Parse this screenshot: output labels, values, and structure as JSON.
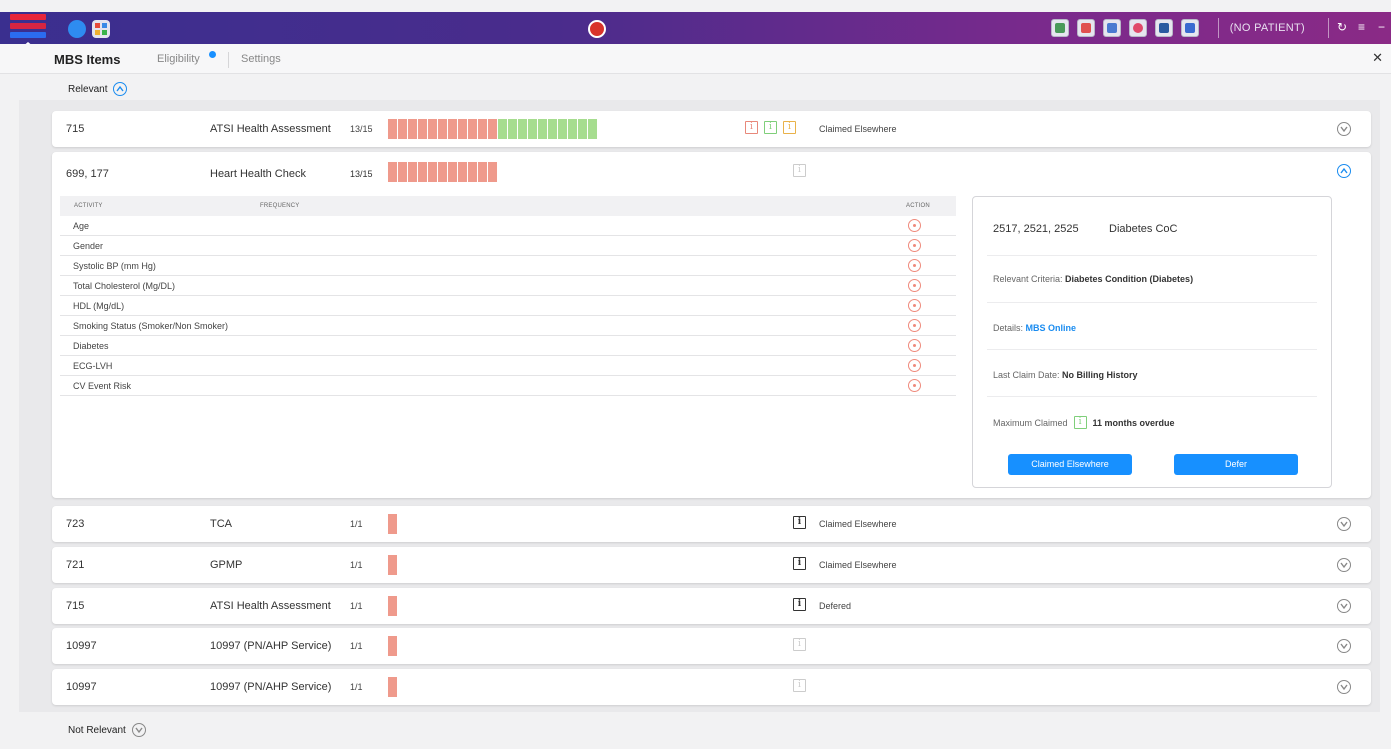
{
  "topbar": {
    "patient_label": "(NO PATIENT)",
    "app_icons": [
      "pathology-icon",
      "mbs-icon",
      "medication-icon",
      "heart-health-icon",
      "qi-icon",
      "mbs-assist-icon"
    ],
    "colors": {
      "bar_start": "#3a2f8f",
      "bar_end": "#8a2a86",
      "stripe_red": "#e8253a",
      "stripe_blue": "#2b6cf0"
    }
  },
  "tabs": [
    {
      "label": "MBS Items",
      "active": true
    },
    {
      "label": "Eligibility",
      "active": false
    },
    {
      "label": "Settings",
      "active": false
    }
  ],
  "sections": {
    "relevant": "Relevant",
    "not_relevant": "Not Relevant"
  },
  "rows": [
    {
      "code": "715",
      "name": "ATSI Health Assessment",
      "ratio": "13/15",
      "status": "Claimed Elsewhere"
    },
    {
      "code": "699, 177",
      "name": "Heart Health Check",
      "ratio": "13/15",
      "status": ""
    },
    {
      "code": "723",
      "name": "TCA",
      "ratio": "1/1",
      "status": "Claimed Elsewhere"
    },
    {
      "code": "721",
      "name": "GPMP",
      "ratio": "1/1",
      "status": "Claimed Elsewhere"
    },
    {
      "code": "715",
      "name": "ATSI Health Assessment",
      "ratio": "1/1",
      "status": "Defered"
    },
    {
      "code": "10997",
      "name": "10997 (PN/AHP Service)",
      "ratio": "1/1",
      "status": ""
    },
    {
      "code": "10997",
      "name": "10997 (PN/AHP Service)",
      "ratio": "1/1",
      "status": ""
    }
  ],
  "activity_table": {
    "headers": {
      "activity": "ACTIVITY",
      "frequency": "FREQUENCY",
      "action": "ACTION"
    },
    "activities": [
      "Age",
      "Gender",
      "Systolic BP (mm Hg)",
      "Total Cholesterol (Mg/DL)",
      "HDL (Mg/dL)",
      "Smoking Status (Smoker/Non Smoker)",
      "Diabetes",
      "ECG-LVH",
      "CV Event Risk"
    ]
  },
  "side_card": {
    "codes": "2517, 2521, 2525",
    "title": "Diabetes CoC",
    "criteria_label": "Relevant Criteria:",
    "criteria_value": "Diabetes Condition (Diabetes)",
    "details_label": "Details:",
    "details_link": "MBS Online",
    "last_claim_label": "Last Claim Date:",
    "last_claim_value": "No Billing History",
    "max_claimed_label": "Maximum Claimed",
    "overdue_value": "11 months overdue",
    "claimed_button": "Claimed Elsewhere",
    "defer_button": "Defer"
  }
}
